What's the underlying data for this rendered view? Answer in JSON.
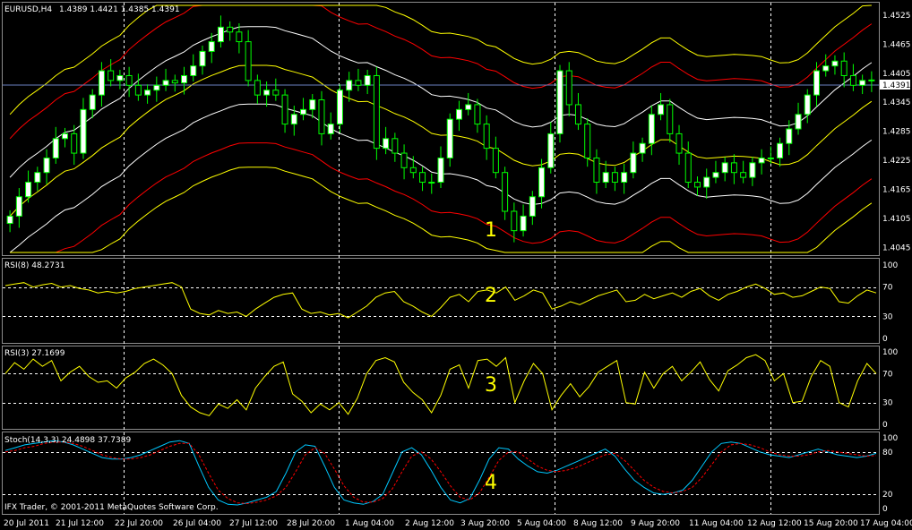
{
  "main": {
    "title": "EURUSD,H4",
    "ohlc": "1.4389 1.4421 1.4385 1.4391",
    "current_price": "1.4391",
    "yticks": [
      "1.4525",
      "1.4465",
      "1.4405",
      "1.4345",
      "1.4285",
      "1.4225",
      "1.4165",
      "1.4105",
      "1.4045"
    ]
  },
  "rsi8": {
    "label": "RSI(8) 48.2731",
    "ticks": [
      "100",
      "70",
      "30",
      "0"
    ]
  },
  "rsi3": {
    "label": "RSI(3) 27.1699",
    "ticks": [
      "100",
      "70",
      "30",
      "0"
    ]
  },
  "stoch": {
    "label": "Stoch(14,3,3) 24.4898 37.7389",
    "ticks": [
      "100",
      "80",
      "20",
      "0"
    ]
  },
  "copyright": "IFX Trader, © 2001-2011 MetaQuotes Software Corp.",
  "xlabels": [
    "20 Jul 2011",
    "21 Jul 12:00",
    "22 Jul 20:00",
    "26 Jul 04:00",
    "27 Jul 12:00",
    "28 Jul 20:00",
    "1 Aug 04:00",
    "2 Aug 12:00",
    "3 Aug 20:00",
    "5 Aug 04:00",
    "8 Aug 12:00",
    "9 Aug 20:00",
    "11 Aug 04:00",
    "12 Aug 12:00",
    "15 Aug 20:00",
    "17 Aug 04:00"
  ],
  "annotations": [
    "1",
    "2",
    "3",
    "4"
  ],
  "colors": {
    "background": "#000000",
    "bull_candle": "#ffffff",
    "bear_candle": "#000000",
    "wick": "#00ff00",
    "grid": "#ffffff",
    "envelope_outer": "#ff0000",
    "envelope_mid": "#ffff00",
    "envelope_white": "#ffffff",
    "rsi": "#ffff00",
    "stoch_main": "#00c8ff",
    "stoch_signal": "#ff0000",
    "price_line": "#6a7fc0",
    "annotation": "#ffff00"
  },
  "chart_data": [
    {
      "type": "line",
      "title": "EURUSD,H4",
      "ylim": [
        1.4035,
        1.4545
      ],
      "close": [
        1.411,
        1.415,
        1.418,
        1.42,
        1.423,
        1.427,
        1.428,
        1.424,
        1.433,
        1.436,
        1.441,
        1.439,
        1.44,
        1.438,
        1.436,
        1.437,
        1.438,
        1.439,
        1.4385,
        1.44,
        1.442,
        1.445,
        1.447,
        1.45,
        1.449,
        1.447,
        1.439,
        1.436,
        1.437,
        1.436,
        1.43,
        1.432,
        1.433,
        1.435,
        1.428,
        1.43,
        1.437,
        1.439,
        1.438,
        1.44,
        1.425,
        1.427,
        1.424,
        1.421,
        1.42,
        1.418,
        1.418,
        1.423,
        1.431,
        1.433,
        1.434,
        1.43,
        1.425,
        1.42,
        1.412,
        1.408,
        1.411,
        1.415,
        1.421,
        1.428,
        1.441,
        1.434,
        1.43,
        1.423,
        1.418,
        1.42,
        1.418,
        1.42,
        1.424,
        1.426,
        1.432,
        1.434,
        1.428,
        1.424,
        1.418,
        1.417,
        1.419,
        1.42,
        1.422,
        1.42,
        1.419,
        1.422,
        1.423,
        1.423,
        1.426,
        1.429,
        1.432,
        1.436,
        1.441,
        1.442,
        1.443,
        1.44,
        1.438,
        1.439,
        1.4391
      ],
      "rsi8": [
        72,
        74,
        76,
        70,
        73,
        75,
        70,
        72,
        68,
        66,
        62,
        64,
        62,
        64,
        68,
        70,
        72,
        74,
        76,
        70,
        40,
        34,
        32,
        38,
        34,
        36,
        30,
        40,
        48,
        56,
        60,
        62,
        40,
        34,
        36,
        32,
        34,
        28,
        36,
        44,
        56,
        62,
        64,
        50,
        44,
        36,
        30,
        42,
        56,
        60,
        50,
        64,
        66,
        62,
        70,
        52,
        58,
        66,
        62,
        40,
        44,
        50,
        46,
        52,
        58,
        62,
        66,
        50,
        52,
        60,
        54,
        58,
        62,
        56,
        64,
        68,
        58,
        52,
        60,
        64,
        70,
        74,
        68,
        60,
        62,
        56,
        58,
        64,
        70,
        68,
        50,
        48,
        58,
        66,
        62
      ],
      "rsi3": [
        70,
        85,
        76,
        90,
        80,
        88,
        60,
        72,
        80,
        66,
        58,
        60,
        50,
        64,
        72,
        84,
        90,
        82,
        70,
        40,
        24,
        16,
        12,
        28,
        22,
        34,
        20,
        50,
        66,
        80,
        86,
        42,
        32,
        16,
        28,
        20,
        30,
        14,
        36,
        70,
        88,
        92,
        86,
        58,
        44,
        34,
        16,
        40,
        76,
        82,
        50,
        88,
        90,
        80,
        92,
        30,
        60,
        84,
        70,
        20,
        40,
        56,
        38,
        52,
        72,
        80,
        88,
        30,
        28,
        72,
        50,
        70,
        80,
        60,
        72,
        86,
        62,
        46,
        74,
        82,
        92,
        96,
        88,
        60,
        70,
        30,
        32,
        66,
        88,
        80,
        30,
        24,
        60,
        84,
        70
      ],
      "stoch_main": [
        82,
        86,
        90,
        92,
        94,
        96,
        94,
        90,
        84,
        78,
        72,
        70,
        70,
        72,
        76,
        82,
        88,
        94,
        96,
        92,
        60,
        30,
        12,
        6,
        5,
        8,
        12,
        16,
        24,
        50,
        80,
        90,
        88,
        60,
        30,
        12,
        8,
        6,
        10,
        20,
        50,
        80,
        86,
        76,
        54,
        30,
        12,
        8,
        14,
        40,
        70,
        86,
        84,
        70,
        60,
        52,
        50,
        54,
        60,
        66,
        72,
        78,
        84,
        74,
        56,
        40,
        30,
        22,
        20,
        22,
        26,
        40,
        60,
        80,
        92,
        94,
        92,
        86,
        80,
        76,
        74,
        72,
        76,
        80,
        84,
        80,
        76,
        74,
        72,
        74,
        78
      ],
      "stoch_signal": [
        80,
        82,
        86,
        88,
        92,
        94,
        94,
        92,
        88,
        82,
        76,
        72,
        70,
        70,
        72,
        76,
        82,
        88,
        92,
        92,
        76,
        50,
        26,
        14,
        8,
        7,
        9,
        12,
        18,
        30,
        52,
        76,
        86,
        78,
        56,
        32,
        16,
        9,
        9,
        14,
        28,
        52,
        74,
        80,
        70,
        52,
        32,
        16,
        12,
        22,
        44,
        68,
        80,
        80,
        70,
        60,
        54,
        52,
        54,
        58,
        64,
        70,
        76,
        78,
        68,
        54,
        40,
        30,
        24,
        22,
        24,
        30,
        44,
        62,
        80,
        90,
        92,
        90,
        86,
        80,
        76,
        74,
        74,
        76,
        80,
        82,
        80,
        78,
        76,
        74,
        75
      ]
    }
  ]
}
